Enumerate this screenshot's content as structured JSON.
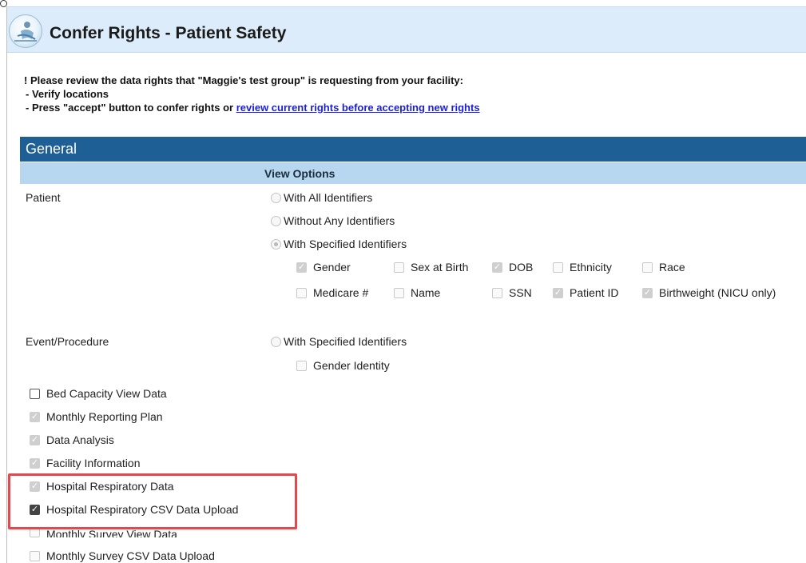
{
  "header": {
    "title": "Confer Rights - Patient Safety"
  },
  "notice": {
    "line1": "! Please review the data rights that \"Maggie's test group\" is requesting from your facility:",
    "line2": "- Verify locations",
    "line3_prefix": "- Press \"accept\" button to confer rights or ",
    "line3_link": "review current rights before accepting new rights"
  },
  "section": {
    "title": "General",
    "column_header": "View Options"
  },
  "patient": {
    "label": "Patient",
    "radio_all": "With All Identifiers",
    "radio_without": "Without Any Identifiers",
    "radio_specified": "With Specified Identifiers",
    "identifiers": {
      "gender": "Gender",
      "sex_at_birth": "Sex at Birth",
      "dob": "DOB",
      "ethnicity": "Ethnicity",
      "race": "Race",
      "medicare": "Medicare #",
      "name": "Name",
      "ssn": "SSN",
      "patient_id": "Patient ID",
      "birthweight": "Birthweight (NICU only)"
    }
  },
  "event": {
    "label": "Event/Procedure",
    "radio_specified": "With Specified Identifiers",
    "gender_identity": "Gender Identity"
  },
  "rights": {
    "bed_capacity": "Bed Capacity View Data",
    "monthly_reporting": "Monthly Reporting Plan",
    "data_analysis": "Data Analysis",
    "facility_info": "Facility Information",
    "hosp_resp_data": "Hospital Respiratory Data",
    "hosp_resp_csv": "Hospital Respiratory CSV Data Upload",
    "monthly_survey_view": "Monthly Survey View Data",
    "monthly_survey_csv": "Monthly Survey CSV Data Upload"
  },
  "colors": {
    "section_bar": "#1e5f95",
    "subheader": "#b7d7f0",
    "header_bg": "#dcecfa",
    "highlight": "#e0494e",
    "link": "#1a1fd6"
  }
}
